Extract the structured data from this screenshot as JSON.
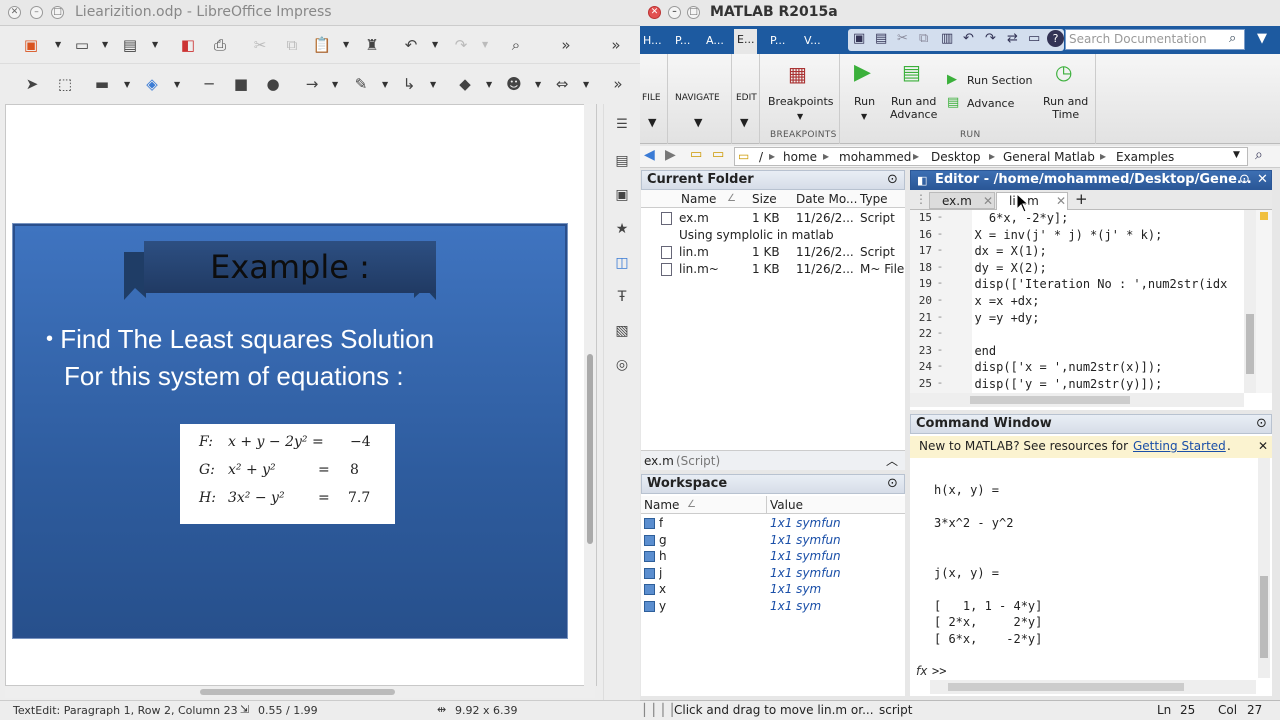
{
  "lo": {
    "title": "Liearizition.odp - LibreOffice Impress",
    "slide": {
      "title": "Example :",
      "bullet_line1": "Find The Least squares Solution",
      "bullet_line2": "For this system of equations :",
      "equations": [
        {
          "name": "F:",
          "lhs": "x + y − 2y² =",
          "rhs": "−4"
        },
        {
          "name": "G:",
          "lhs": "x² + y²",
          "eq": "=",
          "rhs": "8"
        },
        {
          "name": "H:",
          "lhs": "3x² − y²",
          "eq": "=",
          "rhs": "7.7"
        }
      ]
    },
    "status": {
      "left": "TextEdit: Paragraph 1, Row 2, Column 23",
      "position": "0.55 / 1.99",
      "size": "9.92 x 6.39"
    }
  },
  "ml": {
    "title": "MATLAB R2015a",
    "tabs": [
      "H...",
      "P...",
      "A...",
      "E...",
      "P...",
      "V..."
    ],
    "search_placeholder": "Search Documentation",
    "ribbon": {
      "file": "FILE",
      "navigate": "NAVIGATE",
      "edit": "EDIT",
      "breakpoints": "Breakpoints",
      "breakpoints_section": "BREAKPOINTS",
      "run": "Run",
      "run_and_advance_1": "Run and",
      "run_and_advance_2": "Advance",
      "run_section": "Run Section",
      "advance": "Advance",
      "run_and_time_1": "Run and",
      "run_and_time_2": "Time",
      "run_section_label": "RUN"
    },
    "address": [
      "/",
      "home",
      "mohammed",
      "Desktop",
      "General Matlab",
      "Examples"
    ],
    "current_folder": {
      "header": "Current Folder",
      "columns": [
        "Name",
        "Size",
        "Date Mo...",
        "Type"
      ],
      "rows": [
        {
          "name": "ex.m",
          "size": "1 KB",
          "date": "11/26/2...",
          "type": "Script",
          "desc": "Using symplolic in matlab"
        },
        {
          "name": "lin.m",
          "size": "1 KB",
          "date": "11/26/2...",
          "type": "Script"
        },
        {
          "name": "lin.m~",
          "size": "1 KB",
          "date": "11/26/2...",
          "type": "M~ File"
        }
      ],
      "details": "ex.m",
      "details_type": "(Script)"
    },
    "workspace": {
      "header": "Workspace",
      "columns": [
        "Name",
        "Value"
      ],
      "rows": [
        {
          "name": "f",
          "value": "1x1 symfun"
        },
        {
          "name": "g",
          "value": "1x1 symfun"
        },
        {
          "name": "h",
          "value": "1x1 symfun"
        },
        {
          "name": "j",
          "value": "1x1 symfun"
        },
        {
          "name": "x",
          "value": "1x1 sym"
        },
        {
          "name": "y",
          "value": "1x1 sym"
        }
      ]
    },
    "editor": {
      "header": "Editor - /home/mohammed/Desktop/Gene...",
      "tabs": [
        "ex.m",
        "lin.m"
      ],
      "lines": [
        {
          "n": "15",
          "code": "    6*x, -2*y];"
        },
        {
          "n": "16",
          "code": "  X = inv(j' * j) *(j' * k);"
        },
        {
          "n": "17",
          "code": "  dx = X(1);"
        },
        {
          "n": "18",
          "code": "  dy = X(2);"
        },
        {
          "n": "19",
          "code": "  disp(['Iteration No : ',num2str(idx"
        },
        {
          "n": "20",
          "code": "  x =x +dx;"
        },
        {
          "n": "21",
          "code": "  y =y +dy;"
        },
        {
          "n": "22",
          "code": ""
        },
        {
          "n": "23",
          "code": "  end"
        },
        {
          "n": "24",
          "code": "  disp(['x = ',num2str(x)]);"
        },
        {
          "n": "25",
          "code": "  disp(['y = ',num2str(y)]);"
        }
      ]
    },
    "command": {
      "header": "Command Window",
      "banner": "New to MATLAB? See resources for ",
      "banner_link": "Getting Started",
      "banner_end": ".",
      "output": [
        "h(x, y) =",
        "",
        "3*x^2 - y^2",
        "",
        "",
        "j(x, y) =",
        "",
        "[   1, 1 - 4*y]",
        "[ 2*x,     2*y]",
        "[ 6*x,    -2*y]"
      ],
      "prompt": ">>",
      "fx": "fx"
    },
    "status": {
      "message": "Click and drag to move lin.m or...",
      "mode": "script",
      "ln_label": "Ln",
      "ln": "25",
      "col_label": "Col",
      "col": "27"
    }
  }
}
